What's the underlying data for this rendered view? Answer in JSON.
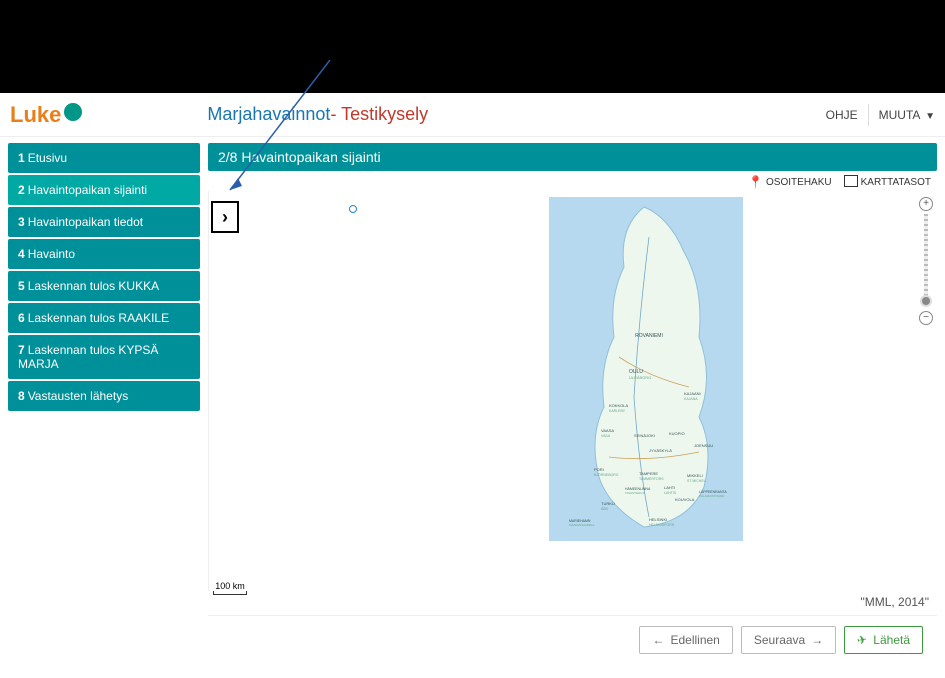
{
  "header": {
    "logo_text": "Luke",
    "title_a": "Marjahavainnot",
    "title_sep": "- ",
    "title_b": "Testikysely",
    "ohje": "OHJE",
    "muuta": "MUUTA"
  },
  "sidebar": {
    "items": [
      {
        "num": "1",
        "label": "Etusivu"
      },
      {
        "num": "2",
        "label": "Havaintopaikan sijainti"
      },
      {
        "num": "3",
        "label": "Havaintopaikan tiedot"
      },
      {
        "num": "4",
        "label": "Havainto"
      },
      {
        "num": "5",
        "label": "Laskennan tulos KUKKA"
      },
      {
        "num": "6",
        "label": "Laskennan tulos RAAKILE"
      },
      {
        "num": "7",
        "label": "Laskennan tulos KYPSÄ MARJA"
      },
      {
        "num": "8",
        "label": "Vastausten lähetys"
      }
    ],
    "active_index": 1
  },
  "section": {
    "heading": "2/8 Havaintopaikan sijainti"
  },
  "toolbar": {
    "osoitehaku": "OSOITEHAKU",
    "karttatasot": "KARTTATASOT"
  },
  "map": {
    "expand_glyph": "›",
    "zoom_plus": "+",
    "zoom_minus": "−",
    "scale_label": "100 km",
    "attribution": "\"MML, 2014\"",
    "cities": [
      "ROVANIEMI",
      "OULU",
      "ULEÅBORG",
      "KAJAANI",
      "KAJANA",
      "KOKKOLA",
      "KARLEBY",
      "VAASA",
      "VASA",
      "SEINÄJOKI",
      "KUOPIO",
      "JYVÄSKYLÄ",
      "JOENSUU",
      "PORI",
      "BJÖRNEBORG",
      "TAMPERE",
      "TAMMERFORS",
      "HÄMEENLINNA",
      "TAVASTEHUS",
      "LAHTI",
      "LAHTIS",
      "MIKKELI",
      "ST MICHEL",
      "KOUVOLA",
      "LAPPEENRANTA",
      "VILLMANSTRAND",
      "TURKU",
      "ÅBO",
      "HELSINKI",
      "HELSINGFORS",
      "MARIEHAMN",
      "MAARIANHAMINA"
    ]
  },
  "footer": {
    "prev": "Edellinen",
    "next": "Seuraava",
    "send": "Lähetä"
  }
}
